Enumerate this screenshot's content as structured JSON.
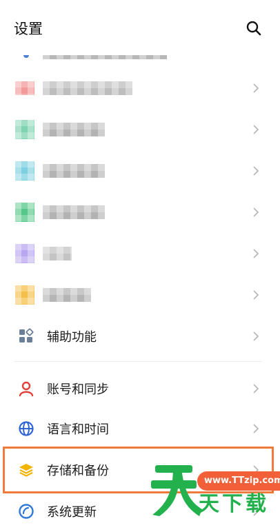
{
  "header": {
    "title": "设置",
    "search_icon": "search-icon"
  },
  "partial_row": {
    "icon": "wifi-icon"
  },
  "blurred_rows": [
    {
      "icon_color": "#f29a9a"
    },
    {
      "icon_color": "#7fd3b0"
    },
    {
      "icon_color": "#7ed0e0"
    },
    {
      "icon_color": "#55c788"
    },
    {
      "icon_color": "#b9a6ef"
    },
    {
      "icon_color": "#f5c04a"
    }
  ],
  "rows": [
    {
      "label": "辅助功能",
      "icon": "accessibility-icon"
    },
    {
      "label": "账号和同步",
      "icon": "person-icon"
    },
    {
      "label": "语言和时间",
      "icon": "globe-icon"
    },
    {
      "label": "存储和备份",
      "icon": "layers-icon"
    },
    {
      "label": "系统更新",
      "icon": "update-icon"
    }
  ],
  "watermark": {
    "site": "www.TTzip.com",
    "name": "天下载"
  },
  "colors": {
    "highlight": "#f07a3c",
    "watermark_green": "#22b14c",
    "watermark_pill": "#f2603a"
  }
}
